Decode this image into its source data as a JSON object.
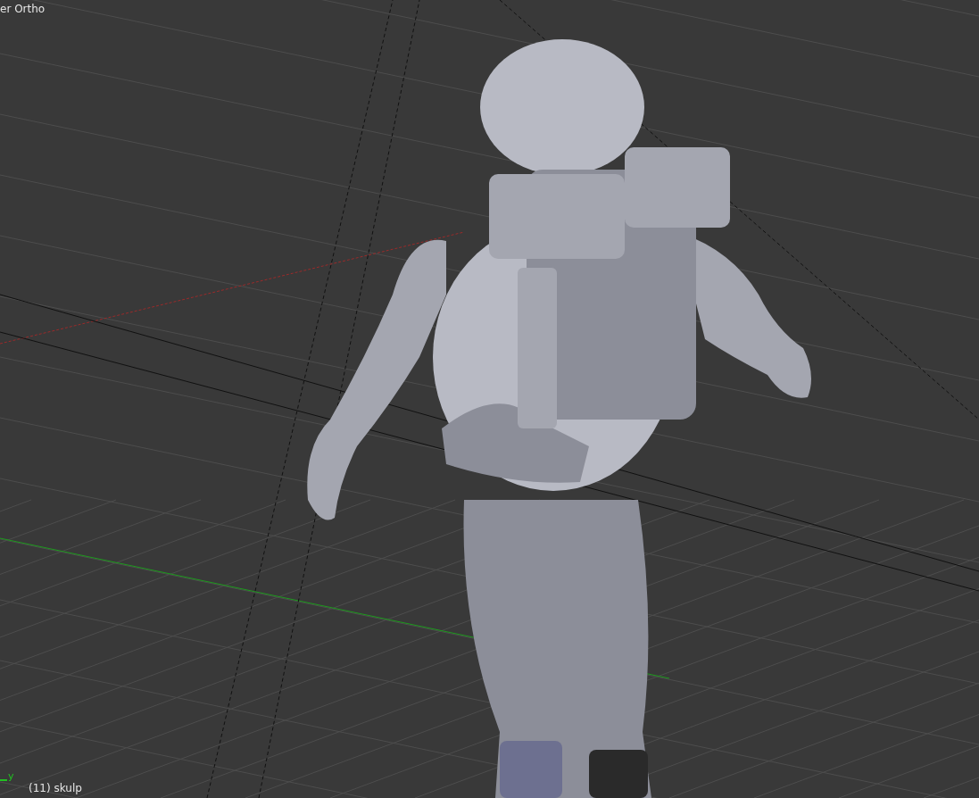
{
  "viewport": {
    "view_label": "er Ortho",
    "object_label": "(11) skulp",
    "axis_label": "y"
  }
}
